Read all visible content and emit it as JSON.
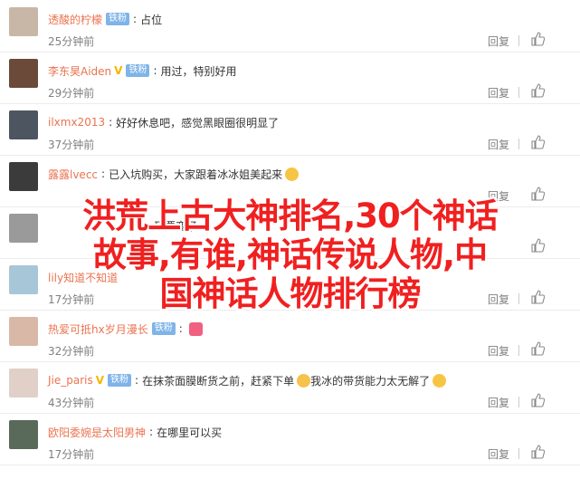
{
  "comments": [
    {
      "user": "透酸的柠檬",
      "vip": "铁粉",
      "badge": "",
      "text": "占位",
      "emoji": "",
      "time": "25分钟前",
      "avatar_color": "#c8b7a6"
    },
    {
      "user": "李东昊Aiden",
      "vip": "铁粉",
      "badge": "V",
      "text": "用过，特别好用",
      "emoji": "",
      "time": "29分钟前",
      "avatar_color": "#6b4a3a"
    },
    {
      "user": "ilxmx2013",
      "vip": "",
      "badge": "",
      "text": "好好休息吧，感觉黑眼圈很明显了",
      "emoji": "",
      "time": "37分钟前",
      "avatar_color": "#4c5560"
    },
    {
      "user": "露露lvecc",
      "vip": "",
      "badge": "",
      "text": "已入坑购买，大家跟着冰冰姐美起来",
      "emoji": "grin",
      "time": "",
      "avatar_color": "#3b3b3b"
    },
    {
      "user": "",
      "vip": "",
      "badge": "",
      "text": "又要变了",
      "emoji": "",
      "time": "",
      "avatar_color": "#9a9a9a"
    },
    {
      "user": "lily知道不知道",
      "vip": "",
      "badge": "",
      "text": "",
      "emoji": "",
      "time": "17分钟前",
      "avatar_color": "#a7c7d8"
    },
    {
      "user": "热爱可抵hx岁月漫长",
      "vip": "铁粉",
      "badge": "",
      "text": "",
      "emoji": "heart",
      "time": "32分钟前",
      "avatar_color": "#d9b8a8"
    },
    {
      "user": "Jie_paris",
      "vip": "铁粉",
      "badge": "V",
      "text": "在抹茶面膜断货之前，赶紧下单",
      "text2": "我冰的带货能力太无解了",
      "emoji": "cat",
      "time": "43分钟前",
      "avatar_color": "#e0d0c8"
    },
    {
      "user": "欧阳委婉是太阳男神",
      "vip": "",
      "badge": "",
      "text": "在哪里可以买",
      "emoji": "",
      "time": "17分钟前",
      "avatar_color": "#5a6a5a"
    }
  ],
  "actions": {
    "reply": "回复"
  },
  "overlay": {
    "line1": "洪荒上古大神排名,30个神话",
    "line2": "故事,有谁,神话传说人物,中",
    "line3": "国神话人物排行榜"
  }
}
